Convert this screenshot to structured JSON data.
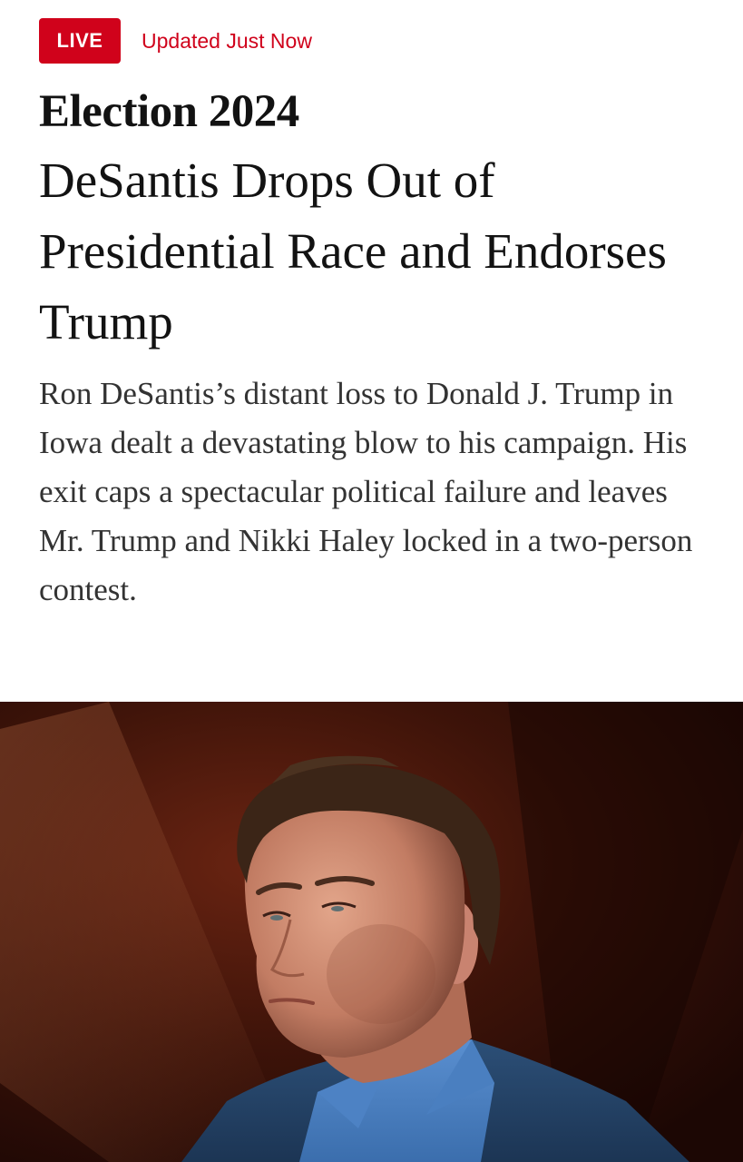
{
  "header": {
    "live_label": "LIVE",
    "updated_label": "Updated Just Now"
  },
  "article": {
    "kicker": "Election 2024",
    "headline": "DeSantis Drops Out of Presidential Race and Endorses Trump",
    "summary": "Ron DeSantis’s distant loss to Donald J. Trump in Iowa dealt a devastating blow to his campaign. His exit caps a spectacular political failure and leaves Mr. Trump and Nikki Haley locked in a two-person contest."
  },
  "photo": {
    "subject": "portrait-of-man-in-blue-jacket"
  },
  "colors": {
    "accent_red": "#d0021b",
    "headline_text": "#121212",
    "body_text": "#333333",
    "photo_background": "#2a0d06"
  }
}
